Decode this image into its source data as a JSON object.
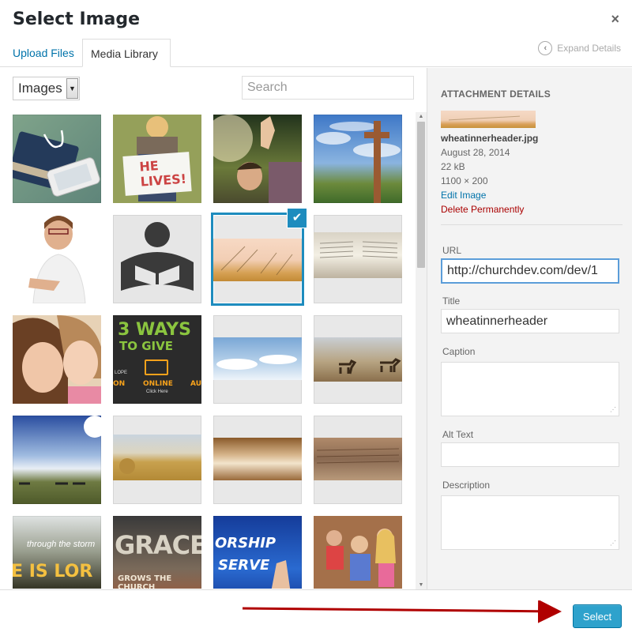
{
  "dialog": {
    "title": "Select Image",
    "close_glyph": "×"
  },
  "tabs": [
    {
      "label": "Upload Files",
      "active": false
    },
    {
      "label": "Media Library",
      "active": true
    }
  ],
  "expand": {
    "label": "Expand Details",
    "icon": "chevron-left-icon"
  },
  "toolbar": {
    "filter_value": "Images",
    "search_placeholder": "Search"
  },
  "grid": {
    "thumbnails": [
      {
        "name": "bible-earbuds-phone"
      },
      {
        "name": "he-lives-sign",
        "text": "HE LIVES!"
      },
      {
        "name": "man-praying-hands-raised"
      },
      {
        "name": "wooden-cross-sky"
      },
      {
        "name": "woman-portrait"
      },
      {
        "name": "reading-icon"
      },
      {
        "name": "wheatinnerheader",
        "selected": true
      },
      {
        "name": "open-bible"
      },
      {
        "name": "two-women-smiling"
      },
      {
        "name": "3-ways-to-give",
        "text_top": "3 WAYS",
        "text_mid": "TO GIVE",
        "text_online": "ONLINE",
        "text_click": "Click Here",
        "text_left": "ON",
        "text_right": "AU",
        "text_lope": "LOPE"
      },
      {
        "name": "sky-clouds-header"
      },
      {
        "name": "horses-field-header"
      },
      {
        "name": "horses-sunset"
      },
      {
        "name": "hay-bales-header"
      },
      {
        "name": "wheat-closeup-header"
      },
      {
        "name": "wheat-text-header"
      },
      {
        "name": "through-the-storm",
        "text_top": "through the storm",
        "text_bottom": "E IS LOR"
      },
      {
        "name": "grace-grows",
        "text_top": "GRACE",
        "text_bottom": "GROWS THE CHURCH"
      },
      {
        "name": "worship-serve",
        "text_top": "ORSHIP",
        "text_bottom": "SERVE"
      },
      {
        "name": "children-seated"
      }
    ]
  },
  "details": {
    "heading": "ATTACHMENT DETAILS",
    "filename": "wheatinnerheader.jpg",
    "date": "August 28, 2014",
    "size": "22 kB",
    "dimensions": "1100 × 200",
    "edit_link": "Edit Image",
    "delete_link": "Delete Permanently",
    "url_label": "URL",
    "url_value": "http://churchdev.com/dev/1",
    "title_label": "Title",
    "title_value": "wheatinnerheader",
    "caption_label": "Caption",
    "caption_value": "",
    "alt_label": "Alt Text",
    "alt_value": "",
    "description_label": "Description",
    "description_value": ""
  },
  "footer": {
    "select_label": "Select"
  },
  "colors": {
    "accent": "#1e8cbe",
    "button": "#2ea2cc",
    "delete": "#aa0000",
    "link": "#0073aa",
    "annotation_arrow": "#b00000"
  }
}
